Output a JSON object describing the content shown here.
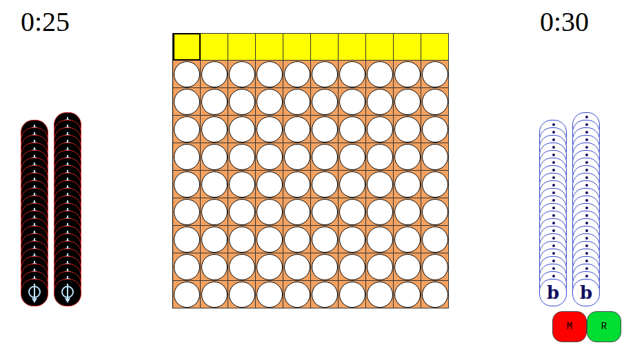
{
  "players": [
    {
      "timer": "0:25",
      "symbol": "",
      "stacks": [
        22,
        23
      ]
    },
    {
      "timer": "0:30",
      "symbol": "b",
      "stacks": [
        22,
        23
      ]
    }
  ],
  "board": {
    "columns": [
      {
        "selected": true
      },
      {
        "selected": false
      },
      {
        "selected": false
      },
      {
        "selected": false
      },
      {
        "selected": false
      },
      {
        "selected": false
      },
      {
        "selected": false
      },
      {
        "selected": false
      },
      {
        "selected": false
      },
      {
        "selected": false
      }
    ],
    "grid": [
      [
        0,
        0,
        0,
        0,
        0,
        0,
        0,
        0,
        0,
        0
      ],
      [
        0,
        0,
        0,
        0,
        0,
        0,
        0,
        0,
        0,
        0
      ],
      [
        0,
        0,
        0,
        0,
        0,
        0,
        0,
        0,
        0,
        0
      ],
      [
        0,
        0,
        0,
        0,
        0,
        0,
        0,
        0,
        0,
        0
      ],
      [
        0,
        0,
        0,
        0,
        0,
        0,
        0,
        0,
        0,
        0
      ],
      [
        0,
        0,
        0,
        0,
        0,
        0,
        0,
        0,
        0,
        0
      ],
      [
        0,
        0,
        0,
        0,
        0,
        0,
        0,
        0,
        0,
        0
      ],
      [
        0,
        0,
        0,
        0,
        0,
        0,
        0,
        0,
        0,
        0
      ],
      [
        0,
        0,
        0,
        0,
        0,
        0,
        0,
        0,
        0,
        0
      ]
    ]
  },
  "buttons": [
    {
      "label": "M",
      "color": "#ff0000"
    },
    {
      "label": "R",
      "color": "#00dd33"
    }
  ]
}
